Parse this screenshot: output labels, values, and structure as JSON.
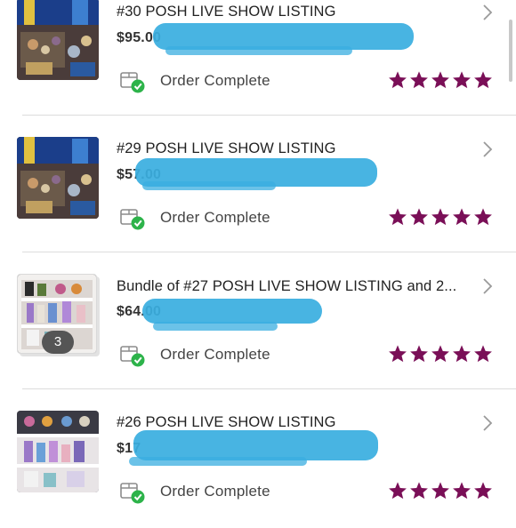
{
  "colors": {
    "accent_star": "#7a0f57",
    "check_green": "#2db34a",
    "redaction_blue": "#3aaee0"
  },
  "orders": [
    {
      "title": "#30 POSH LIVE SHOW LISTING",
      "price": "$95.00",
      "status": "Order Complete",
      "rating": 5
    },
    {
      "title": "#29 POSH LIVE SHOW LISTING",
      "price": "$57.00",
      "status": "Order Complete",
      "rating": 5
    },
    {
      "title": "Bundle of #27 POSH LIVE SHOW LISTING and 2...",
      "price": "$64.00",
      "status": "Order Complete",
      "rating": 5,
      "bundle_count": "3"
    },
    {
      "title": "#26 POSH LIVE SHOW LISTING",
      "price": "$17",
      "status": "Order Complete",
      "rating": 5
    }
  ],
  "icons": {
    "chevron": "chevron-right-icon",
    "status": "package-check-icon",
    "star": "star-icon"
  }
}
